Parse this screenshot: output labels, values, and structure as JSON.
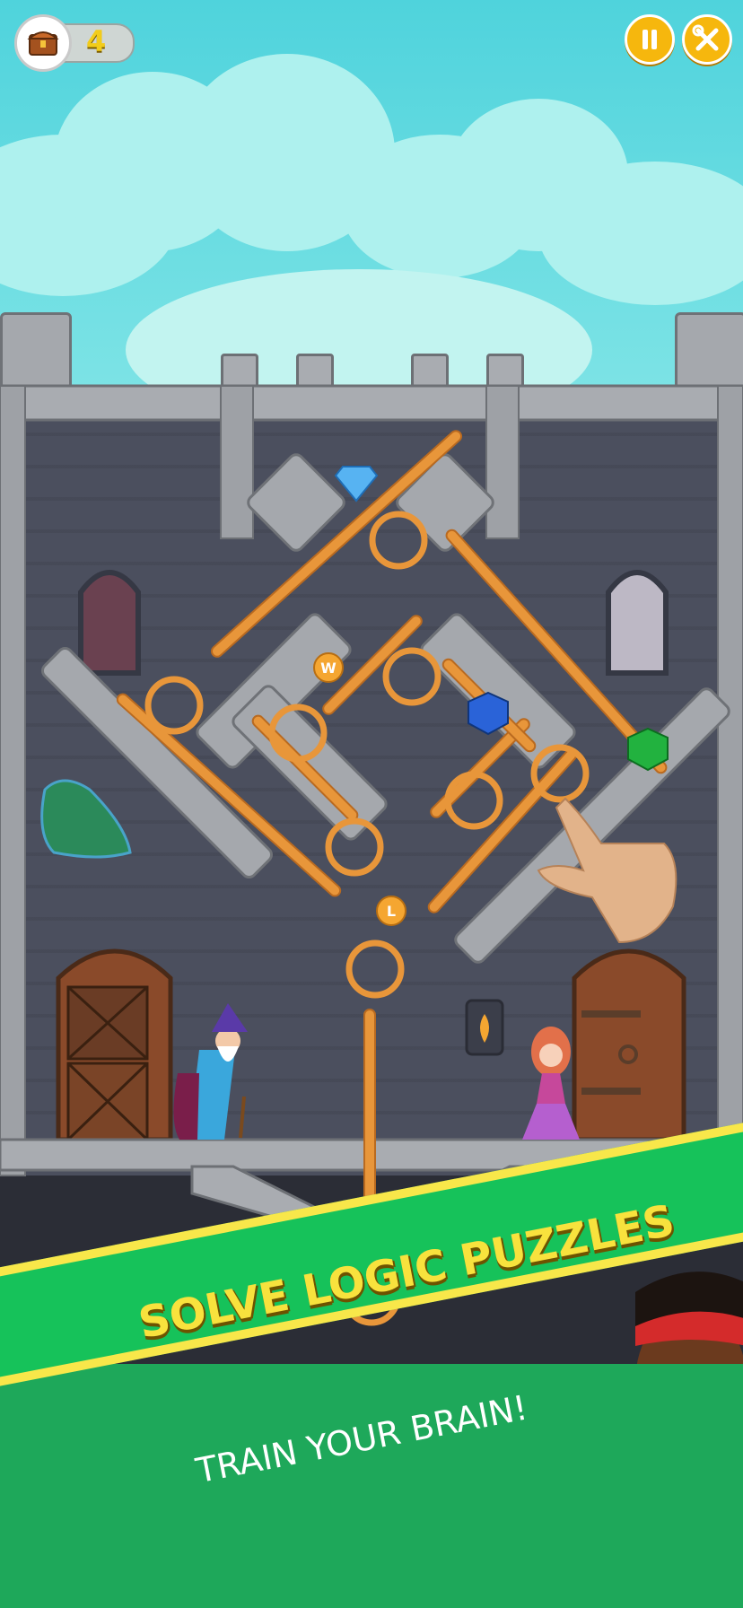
{
  "hud": {
    "chest_count": "4",
    "icons": [
      "treasure-chest-icon",
      "pause-icon",
      "settings-tools-icon"
    ]
  },
  "promo": {
    "headline": "SOLVE LOGIC PUZZLES",
    "subline": "TRAIN YOUR BRAIN!"
  },
  "scene": {
    "coins": [
      "W",
      "L"
    ],
    "characters": [
      "wizard",
      "princess",
      "guide-character"
    ],
    "gems": [
      "blue-diamond",
      "blue-sapphire",
      "green-emerald"
    ]
  },
  "colors": {
    "sky": "#4fd3dc",
    "castle_wall": "#4b4f5e",
    "pin": "#e8963a",
    "banner": "#16c25a",
    "headline": "#f8e23d",
    "button": "#f6b70d"
  }
}
